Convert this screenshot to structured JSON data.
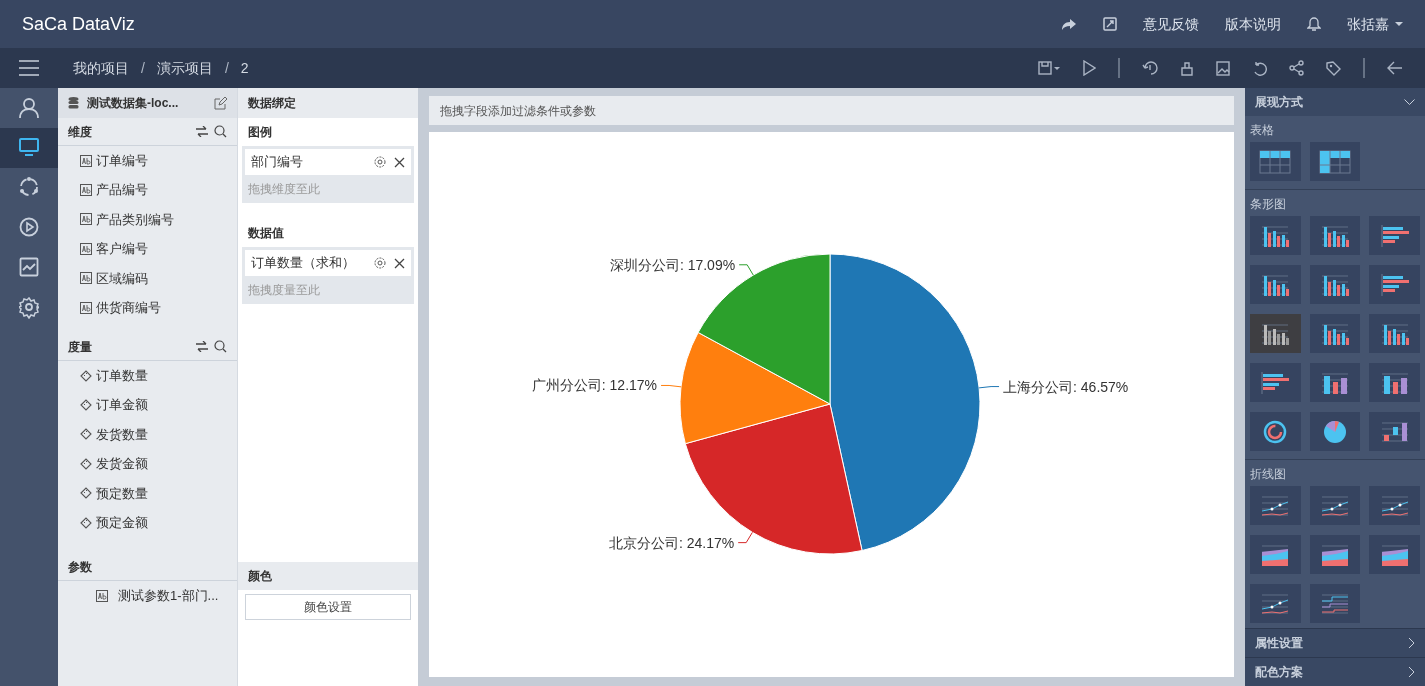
{
  "app": {
    "logo": "SaCa DataViz",
    "header_links": [
      "意见反馈",
      "版本说明"
    ],
    "user": "张括嘉"
  },
  "breadcrumb": [
    {
      "kind": "link",
      "text": "我的项目"
    },
    {
      "kind": "separator",
      "text": "/"
    },
    {
      "kind": "link",
      "text": "演示项目"
    },
    {
      "kind": "separator",
      "text": "/"
    },
    {
      "kind": "link",
      "text": "2"
    }
  ],
  "nav": [
    {
      "selected": false
    },
    {
      "selected": true
    },
    {
      "selected": false
    },
    {
      "selected": false
    },
    {
      "selected": false
    },
    {
      "selected": false
    }
  ],
  "dataset": {
    "title": "测试数据集-loc...",
    "dimensions": {
      "title": "维度",
      "items": [
        "订单编号",
        "产品编号",
        "产品类别编号",
        "客户编号",
        "区域编码",
        "供货商编号"
      ]
    },
    "measures": {
      "title": "度量",
      "items": [
        "订单数量",
        "订单金额",
        "发货数量",
        "发货金额",
        "预定数量",
        "预定金额"
      ]
    },
    "params": {
      "title": "参数",
      "items": [
        "测试参数1-部门..."
      ]
    }
  },
  "binding": {
    "title": "数据绑定",
    "sections": [
      {
        "title": "图例",
        "fields": [
          "部门编号"
        ],
        "hint": "拖拽维度至此"
      },
      {
        "title": "数据值",
        "fields": [
          "订单数量（求和）"
        ],
        "hint": "拖拽度量至此"
      }
    ],
    "color": {
      "title": "颜色",
      "button": "颜色设置"
    }
  },
  "filter_bar": {
    "placeholder": "拖拽字段添加过滤条件或参数"
  },
  "chart": {
    "chart_data": {
      "type": "pie",
      "values": [
        46.57,
        24.17,
        12.17,
        17.09
      ],
      "colors": [
        "#1f77b4",
        "#d62728",
        "#ff7f0e",
        "#2ca02c"
      ],
      "value_labels": [
        "上海分公司: 46.57%",
        "北京分公司: 24.17%",
        "广州分公司: 12.17%",
        "深圳分公司: 17.09%"
      ]
    }
  },
  "right_panel": {
    "title": "展现方式",
    "groups": [
      {
        "title": "表格",
        "items": [
          {
            "kind": "table",
            "selected": false
          },
          {
            "kind": "table-header",
            "selected": false
          }
        ]
      },
      {
        "title": "条形图",
        "items": [
          {
            "kind": "bar-stacked",
            "selected": false
          },
          {
            "kind": "bar-stacked",
            "selected": false
          },
          {
            "kind": "hbar",
            "selected": false
          },
          {
            "kind": "bar",
            "selected": false
          },
          {
            "kind": "bar",
            "selected": false
          },
          {
            "kind": "hbar",
            "selected": false
          },
          {
            "kind": "bar",
            "selected": true
          },
          {
            "kind": "bar",
            "selected": false
          },
          {
            "kind": "bar",
            "selected": false
          },
          {
            "kind": "hbar",
            "selected": false
          },
          {
            "kind": "bar-3d",
            "selected": false
          },
          {
            "kind": "bar-3d",
            "selected": false
          },
          {
            "kind": "ring",
            "selected": false
          },
          {
            "kind": "pie",
            "selected": false
          },
          {
            "kind": "waterfall",
            "selected": false
          }
        ]
      },
      {
        "title": "折线图",
        "items": [
          {
            "kind": "line",
            "selected": false
          },
          {
            "kind": "line",
            "selected": false
          },
          {
            "kind": "line",
            "selected": false
          },
          {
            "kind": "area",
            "selected": false
          },
          {
            "kind": "area",
            "selected": false
          },
          {
            "kind": "area",
            "selected": false
          },
          {
            "kind": "line",
            "selected": false
          },
          {
            "kind": "step",
            "selected": false
          }
        ]
      }
    ],
    "footer": [
      "属性设置",
      "配色方案"
    ]
  }
}
